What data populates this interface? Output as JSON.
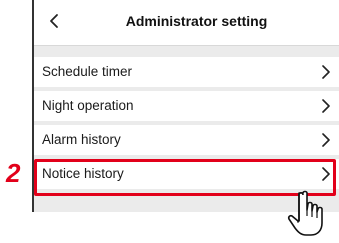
{
  "header": {
    "title": "Administrator setting",
    "back_icon": "chevron-left-icon"
  },
  "menu": {
    "items": [
      {
        "label": "Schedule timer",
        "icon": "chevron-right-icon"
      },
      {
        "label": "Night operation",
        "icon": "chevron-right-icon"
      },
      {
        "label": "Alarm history",
        "icon": "chevron-right-icon"
      },
      {
        "label": "Notice history",
        "icon": "chevron-right-icon",
        "highlighted": true
      }
    ]
  },
  "annotation": {
    "step_number": "2",
    "highlight_color": "#e2001a",
    "pointer_icon": "hand-pointer-icon"
  }
}
